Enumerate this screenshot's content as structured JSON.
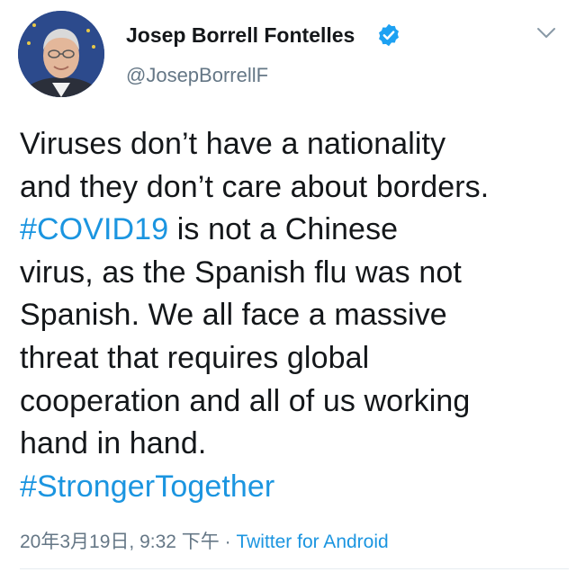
{
  "author": {
    "name": "Josep Borrell Fontelles",
    "handle": "@JosepBorrellF",
    "verified": true
  },
  "tweet": {
    "lines": [
      [
        {
          "text": "Viruses don’t have a nationality",
          "type": "plain"
        }
      ],
      [
        {
          "text": "and they don’t care about borders.",
          "type": "plain"
        }
      ],
      [
        {
          "text": "#COVID19",
          "type": "hashtag"
        },
        {
          "text": " is not a Chinese",
          "type": "plain"
        }
      ],
      [
        {
          "text": "virus, as the Spanish flu was not",
          "type": "plain"
        }
      ],
      [
        {
          "text": "Spanish. We all face a massive",
          "type": "plain"
        }
      ],
      [
        {
          "text": "threat that requires global",
          "type": "plain"
        }
      ],
      [
        {
          "text": "cooperation and all of us working",
          "type": "plain"
        }
      ],
      [
        {
          "text": "hand in hand.",
          "type": "plain"
        }
      ],
      [
        {
          "text": "#StrongerTogether",
          "type": "hashtag"
        }
      ]
    ]
  },
  "meta": {
    "timestamp": "20年3月19日, 9:32 下午",
    "separator": " · ",
    "source": "Twitter for Android"
  },
  "icons": {
    "verified": "verified-badge-icon",
    "more": "chevron-down-icon"
  },
  "colors": {
    "link": "#1b95e0",
    "text": "#14171a",
    "secondary": "#657786",
    "verified": "#1da1f2"
  }
}
